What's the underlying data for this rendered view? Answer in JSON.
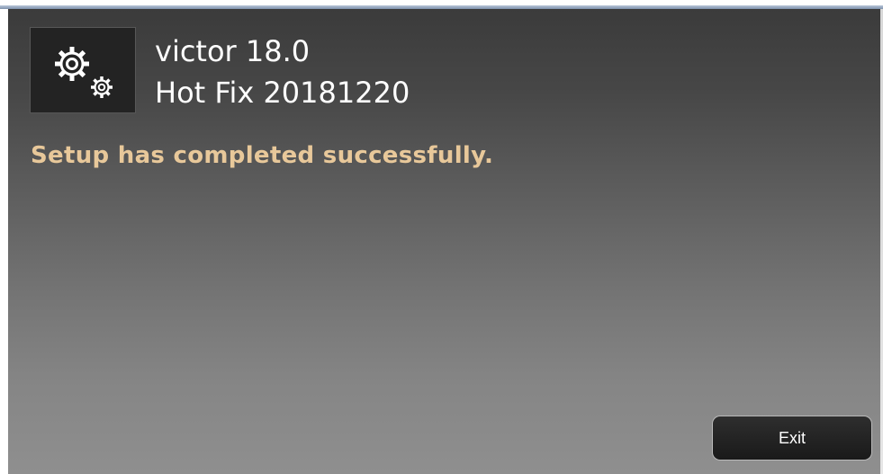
{
  "app": {
    "product_name": "victor 18.0",
    "hotfix_name": "Hot Fix 20181220",
    "icon": "gears-icon"
  },
  "main": {
    "status_message": "Setup has completed successfully."
  },
  "footer": {
    "exit_label": "Exit"
  },
  "colors": {
    "status_text": "#e8c89a",
    "title_text": "#ffffff",
    "button_bg": "#1f1f1f"
  }
}
